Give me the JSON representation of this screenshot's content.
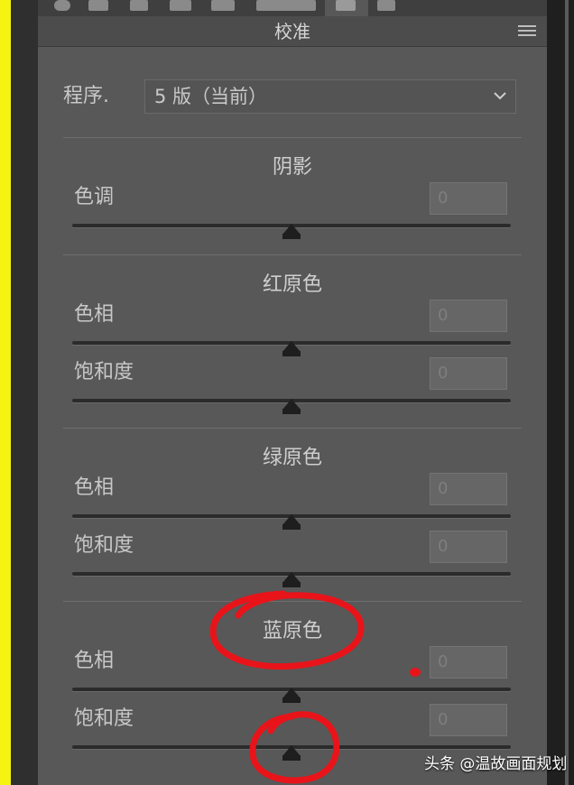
{
  "panel": {
    "title": "校准",
    "tab_icons": [
      "circle-icon",
      "grid-icon",
      "mountain-icon",
      "square-icon",
      "square-filled-icon",
      "fx-icon",
      "calibration-icon",
      "camera-icon"
    ],
    "menu_icon": "panel-menu-icon"
  },
  "process": {
    "label": "程序.",
    "value": "5 版（当前）",
    "chevron_icon": "chevron-down-icon"
  },
  "sections": [
    {
      "title": "阴影",
      "sliders": [
        {
          "label": "色调",
          "value": "0",
          "position": 0.5
        }
      ]
    },
    {
      "title": "红原色",
      "sliders": [
        {
          "label": "色相",
          "value": "0",
          "position": 0.5
        },
        {
          "label": "饱和度",
          "value": "0",
          "position": 0.5
        }
      ]
    },
    {
      "title": "绿原色",
      "sliders": [
        {
          "label": "色相",
          "value": "0",
          "position": 0.5
        },
        {
          "label": "饱和度",
          "value": "0",
          "position": 0.5
        }
      ]
    },
    {
      "title": "蓝原色",
      "sliders": [
        {
          "label": "色相",
          "value": "0",
          "position": 0.5
        },
        {
          "label": "饱和度",
          "value": "0",
          "position": 0.5
        }
      ]
    }
  ],
  "watermark": "头条 @温故画面规划",
  "colors": {
    "highlight_border": "#f4f311",
    "annotation": "#e8141a",
    "panel_bg": "#585858"
  }
}
